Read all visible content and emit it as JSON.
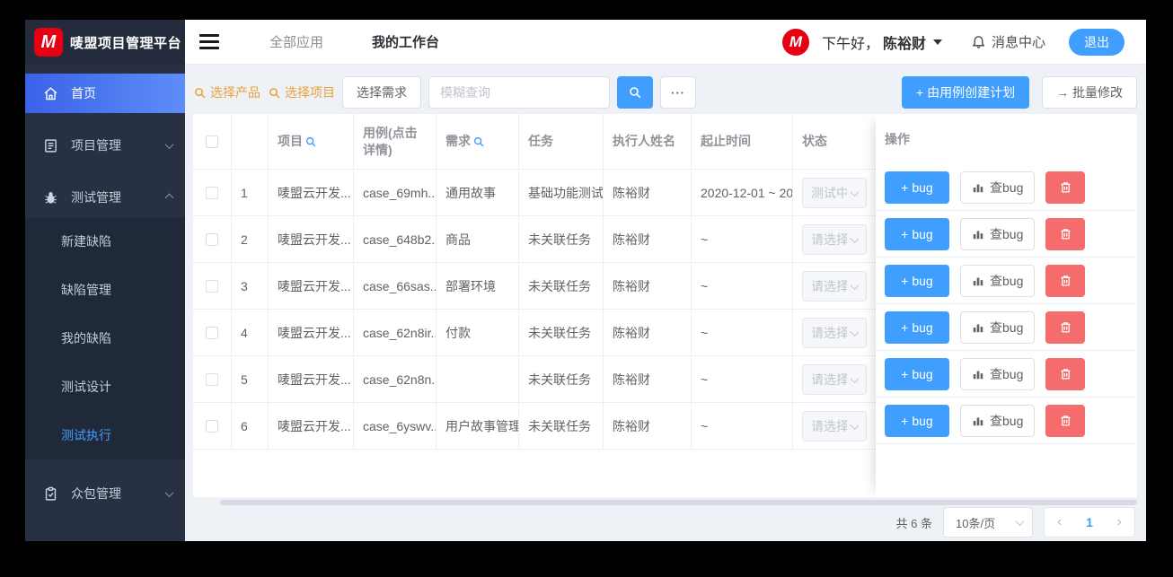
{
  "app": {
    "logo_letter": "M",
    "title": "唛盟项目管理平台"
  },
  "sidebar": {
    "items": [
      {
        "label": "首页"
      },
      {
        "label": "项目管理"
      },
      {
        "label": "测试管理"
      },
      {
        "label": "众包管理"
      }
    ],
    "submenu": [
      "新建缺陷",
      "缺陷管理",
      "我的缺陷",
      "测试设计",
      "测试执行"
    ],
    "active_item": "首页",
    "active_submenu": "测试执行"
  },
  "header": {
    "tabs": [
      "全部应用",
      "我的工作台"
    ],
    "avatar_letter": "M",
    "greeting": "下午好，",
    "username": "陈裕财",
    "message_center": "消息中心",
    "logout": "退出"
  },
  "toolbar": {
    "select_product": "选择产品",
    "select_project": "选择项目",
    "select_requirement": "选择需求",
    "search_placeholder": "模糊查询",
    "more_label": "···",
    "create_plan": "+ 由用例创建计划",
    "batch_edit": "→ 批量修改"
  },
  "table": {
    "columns": {
      "project": "项目",
      "case": "用例(点击详情)",
      "requirement": "需求",
      "task": "任务",
      "executor": "执行人姓名",
      "time": "起止时间",
      "status": "状态",
      "ops": "操作"
    },
    "ops": {
      "add_bug": "+ bug",
      "view_bug": "查bug"
    },
    "rows": [
      {
        "index": "1",
        "project": "唛盟云开发...",
        "case_id": "case_69mh...",
        "requirement": "通用故事",
        "task": "基础功能测试",
        "executor": "陈裕财",
        "time": "2020-12-01 ~ 20",
        "status": "测试中"
      },
      {
        "index": "2",
        "project": "唛盟云开发...",
        "case_id": "case_648b2...",
        "requirement": "商品",
        "task": "未关联任务",
        "executor": "陈裕财",
        "time": "~",
        "status": "请选择"
      },
      {
        "index": "3",
        "project": "唛盟云开发...",
        "case_id": "case_66sas...",
        "requirement": "部署环境",
        "task": "未关联任务",
        "executor": "陈裕财",
        "time": "~",
        "status": "请选择"
      },
      {
        "index": "4",
        "project": "唛盟云开发...",
        "case_id": "case_62n8ir...",
        "requirement": "付款",
        "task": "未关联任务",
        "executor": "陈裕财",
        "time": "~",
        "status": "请选择"
      },
      {
        "index": "5",
        "project": "唛盟云开发...",
        "case_id": "case_62n8n...",
        "requirement": "",
        "task": "未关联任务",
        "executor": "陈裕财",
        "time": "~",
        "status": "请选择"
      },
      {
        "index": "6",
        "project": "唛盟云开发...",
        "case_id": "case_6yswv...",
        "requirement": "用户故事管理",
        "task": "未关联任务",
        "executor": "陈裕财",
        "time": "~",
        "status": "请选择"
      }
    ]
  },
  "pagination": {
    "total": "共 6 条",
    "page_size": "10条/页",
    "prev": "‹",
    "current_page": "1",
    "next": "›"
  }
}
